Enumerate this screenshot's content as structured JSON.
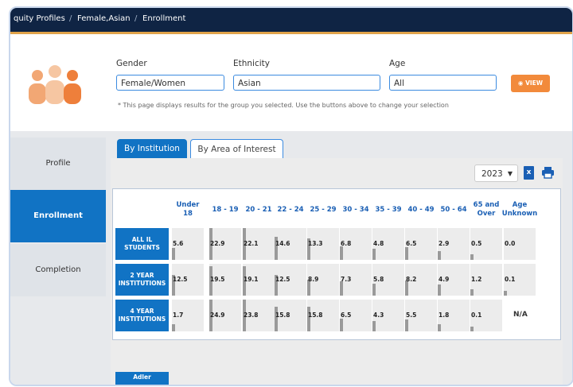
{
  "breadcrumb": [
    "quity Profiles",
    "Female,Asian",
    "Enrollment"
  ],
  "selectors": {
    "gender": {
      "label": "Gender",
      "value": "Female/Women"
    },
    "ethnicity": {
      "label": "Ethnicity",
      "value": "Asian"
    },
    "age": {
      "label": "Age",
      "value": "All"
    },
    "view_button": "VIEW",
    "note": "* This page displays results for the group you selected. Use the buttons above to change your selection"
  },
  "sidebar": [
    {
      "label": "Profile",
      "active": false
    },
    {
      "label": "Enrollment",
      "active": true
    },
    {
      "label": "Completion",
      "active": false
    }
  ],
  "tabs": [
    {
      "label": "By Institution",
      "active": true
    },
    {
      "label": "By Area of Interest",
      "active": false
    }
  ],
  "year": "2023",
  "table": {
    "columns": [
      [
        "Under",
        "18"
      ],
      [
        "18 - 19"
      ],
      [
        "20 - 21"
      ],
      [
        "22 - 24"
      ],
      [
        "25 - 29"
      ],
      [
        "30 - 34"
      ],
      [
        "35 - 39"
      ],
      [
        "40 - 49"
      ],
      [
        "50 - 64"
      ],
      [
        "65 and",
        "Over"
      ],
      [
        "Age",
        "Unknown"
      ]
    ],
    "rows": [
      {
        "label": [
          "ALL IL",
          "STUDENTS"
        ],
        "values": [
          "5.6",
          "22.9",
          "22.1",
          "14.6",
          "13.3",
          "6.8",
          "4.8",
          "6.5",
          "2.9",
          "0.5",
          "0.0"
        ],
        "fill": [
          0.056,
          0.229,
          0.221,
          0.146,
          0.133,
          0.068,
          0.048,
          0.065,
          0.029,
          0.005,
          0.0
        ]
      },
      {
        "label": [
          "2 YEAR",
          "INSTITUTIONS"
        ],
        "values": [
          "12.5",
          "19.5",
          "19.1",
          "12.5",
          "8.9",
          "7.3",
          "5.8",
          "8.2",
          "4.9",
          "1.2",
          "0.1"
        ],
        "fill": [
          0.125,
          0.195,
          0.191,
          0.125,
          0.089,
          0.073,
          0.058,
          0.082,
          0.049,
          0.012,
          0.001
        ]
      },
      {
        "label": [
          "4 YEAR",
          "INSTITUTIONS"
        ],
        "values": [
          "1.7",
          "24.9",
          "23.8",
          "15.8",
          "15.8",
          "6.5",
          "4.3",
          "5.5",
          "1.8",
          "0.1",
          "N/A"
        ],
        "fill": [
          0.017,
          0.249,
          0.238,
          0.158,
          0.158,
          0.065,
          0.043,
          0.055,
          0.018,
          0.001,
          0.0
        ]
      }
    ],
    "partial_row_label": "Adler"
  }
}
